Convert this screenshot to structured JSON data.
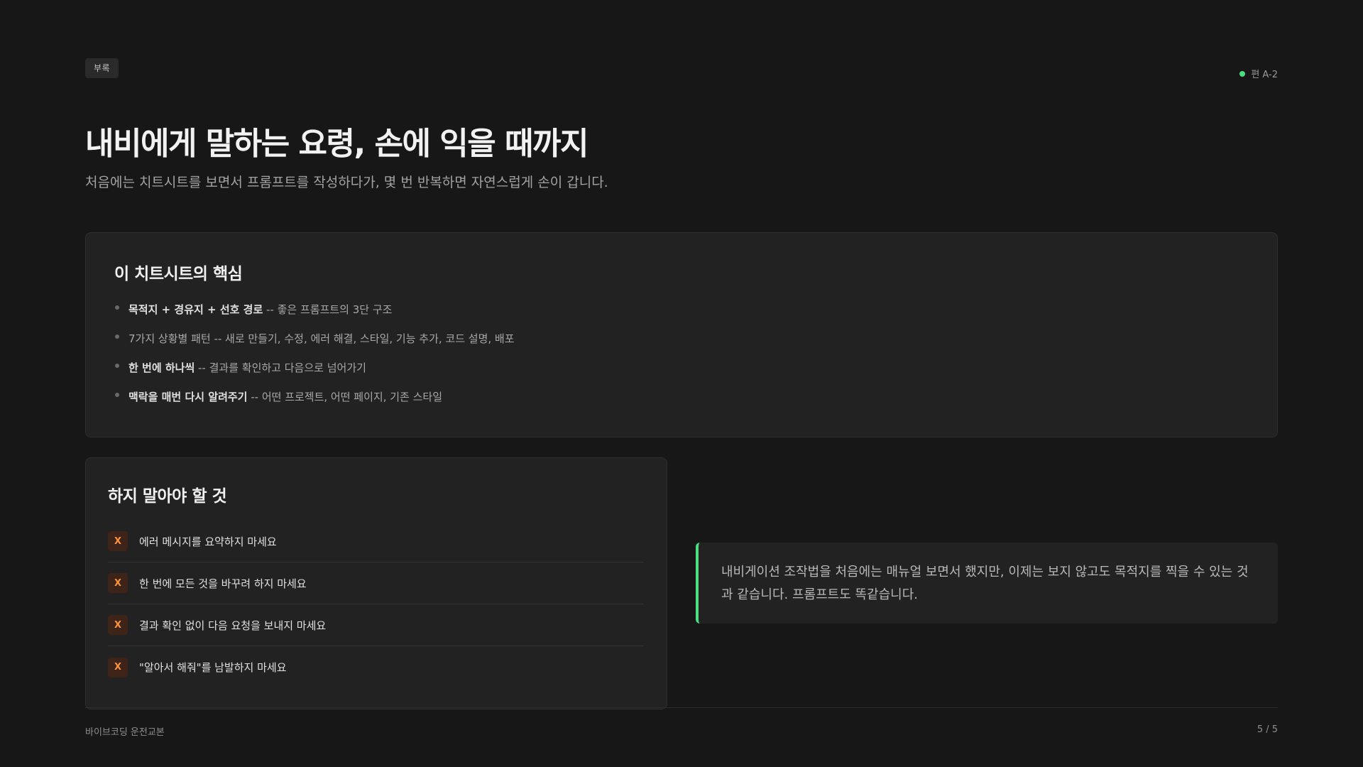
{
  "header": {
    "tag": "부록",
    "reference": "편 A-2",
    "title": "내비에게 말하는 요령, 손에 익을 때까지",
    "subtitle": "처음에는 치트시트를 보면서 프롬프트를 작성하다가, 몇 번 반복하면 자연스럽게 손이 갑니다."
  },
  "summary": {
    "title": "이 치트시트의 핵심",
    "items": [
      {
        "bold": "목적지 + 경유지 + 선호 경로",
        "rest": " -- 좋은 프롬프트의 3단 구조"
      },
      {
        "bold": "",
        "rest": "7가지 상황별 패턴 -- 새로 만들기, 수정, 에러 해결, 스타일, 기능 추가, 코드 설명, 배포"
      },
      {
        "bold": "한 번에 하나씩",
        "rest": " -- 결과를 확인하고 다음으로 넘어가기"
      },
      {
        "bold": "맥락을 매번 다시 알려주기",
        "rest": " -- 어떤 프로젝트, 어떤 페이지, 기존 스타일"
      }
    ]
  },
  "donts": {
    "title": "하지 말아야 할 것",
    "badge": "X",
    "items": [
      "에러 메시지를 요약하지 마세요",
      "한 번에 모든 것을 바꾸려 하지 마세요",
      "결과 확인 없이 다음 요청을 보내지 마세요",
      "\"알아서 해줘\"를 남발하지 마세요"
    ]
  },
  "quote": {
    "text": "내비게이션 조작법을 처음에는 매뉴얼 보면서 했지만, 이제는 보지 않고도 목적지를 찍을 수 있는 것과 같습니다. 프롬프트도 똑같습니다."
  },
  "footer": {
    "left": "바이브코딩 운전교본",
    "right": "5 / 5"
  },
  "colors": {
    "background": "#171717",
    "card": "#222222",
    "accent": "#4ade80",
    "warning": "#fb923c"
  }
}
